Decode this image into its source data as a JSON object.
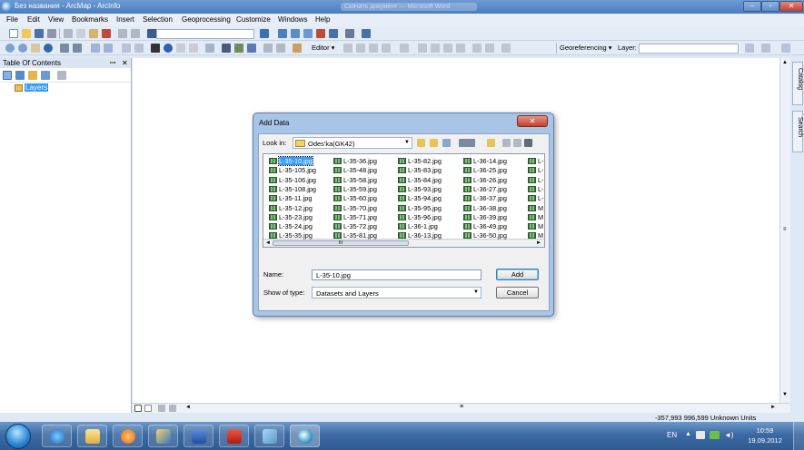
{
  "window": {
    "title": "Без названия - ArcMap - ArcInfo",
    "blurred_title": "Скачать документ — Microsoft Word"
  },
  "menu": [
    "File",
    "Edit",
    "View",
    "Bookmarks",
    "Insert",
    "Selection",
    "Geoprocessing",
    "Customize",
    "Windows",
    "Help"
  ],
  "toolbar": {
    "editor_label": "Editor ▾",
    "georeferencing_label": "Georeferencing ▾",
    "layer_label": "Layer:"
  },
  "toc": {
    "title": "Table Of Contents",
    "layers_label": "Layers"
  },
  "side_tabs": {
    "catalog": "Catalog",
    "search": "Search"
  },
  "dialog": {
    "title": "Add Data",
    "look_in_label": "Look in:",
    "look_in_value": "Odes'ka(GK42)",
    "name_label": "Name:",
    "name_value": "L-35-10.jpg",
    "type_label": "Show of type:",
    "type_value": "Datasets and Layers",
    "add_label": "Add",
    "cancel_label": "Cancel",
    "scroll_center": "III",
    "files": [
      [
        "L-35-10.jpg",
        "L-35-105.jpg",
        "L-35-106.jpg",
        "L-35-108.jpg",
        "L-35-11.jpg",
        "L-35-12.jpg",
        "L-35-23.jpg",
        "L-35-24.jpg",
        "L-35-35.jpg"
      ],
      [
        "L-35-36.jpg",
        "L-35-48.jpg",
        "L-35-58.jpg",
        "L-35-59.jpg",
        "L-35-60.jpg",
        "L-35-70.jpg",
        "L-35-71.jpg",
        "L-35-72.jpg",
        "L-35-81.jpg"
      ],
      [
        "L-35-82.jpg",
        "L-35-83.jpg",
        "L-35-84.jpg",
        "L-35-93.jpg",
        "L-35-94.jpg",
        "L-35-95.jpg",
        "L-35-96.jpg",
        "L-36-1.jpg",
        "L-36-13.jpg"
      ],
      [
        "L-36-14.jpg",
        "L-36-25.jpg",
        "L-36-26.jpg",
        "L-36-27.jpg",
        "L-36-37.jpg",
        "L-36-38.jpg",
        "L-36-39.jpg",
        "L-36-49.jpg",
        "L-36-50.jpg"
      ],
      [
        "L-",
        "L-",
        "L-",
        "L-",
        "L-",
        "M",
        "M",
        "M",
        "M"
      ]
    ]
  },
  "status": {
    "coords": "-357,993  996,599 Unknown Units"
  },
  "tray": {
    "lang": "EN",
    "time": "10:59",
    "date": "19.09.2012"
  },
  "colors": {
    "titlebar": "#4a7cc0",
    "selection": "#3399ff",
    "close_button": "#c7402f",
    "taskbar": "#3c6aa3"
  }
}
